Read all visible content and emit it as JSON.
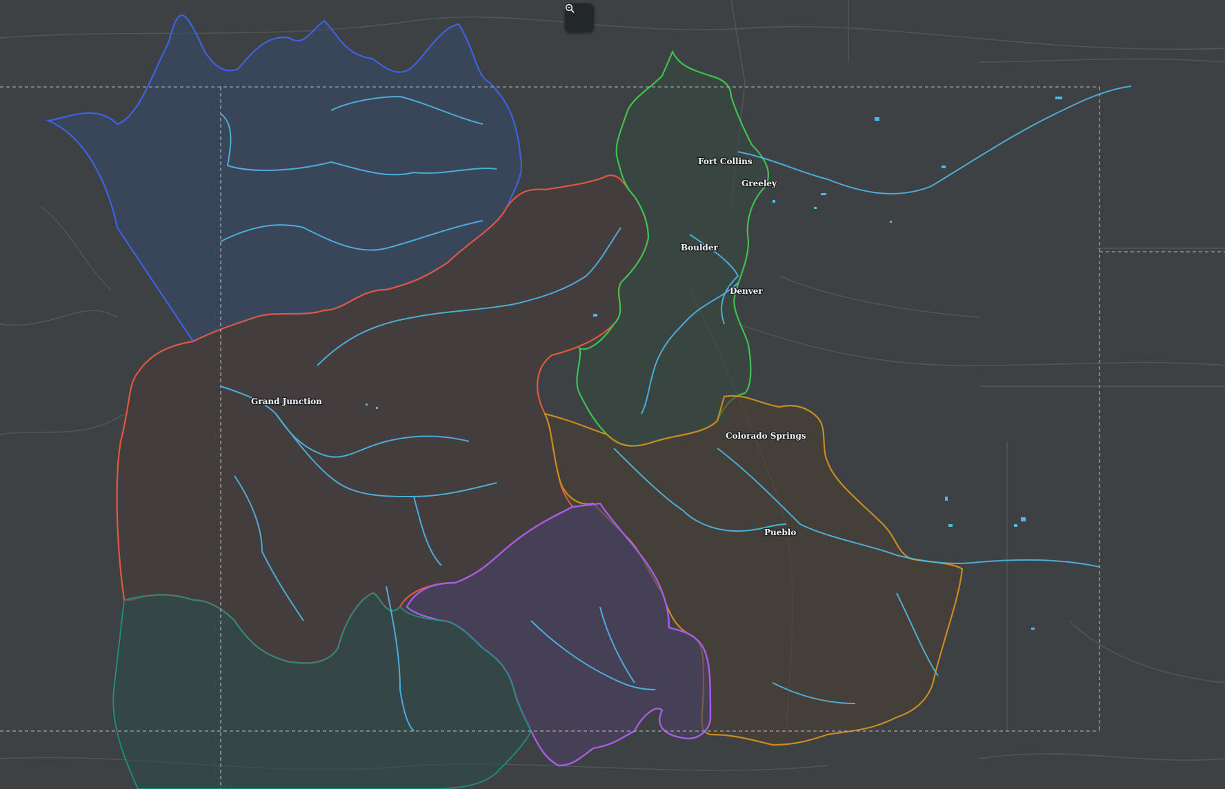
{
  "map": {
    "cities": [
      {
        "name": "Fort Collins"
      },
      {
        "name": "Greeley"
      },
      {
        "name": "Boulder"
      },
      {
        "name": "Denver"
      },
      {
        "name": "Grand Junction"
      },
      {
        "name": "Colorado Springs"
      },
      {
        "name": "Pueblo"
      }
    ],
    "basins": [
      {
        "id": "yampa-white",
        "color": "#3d63e0"
      },
      {
        "id": "colorado",
        "color": "#e0583e"
      },
      {
        "id": "south-platte",
        "color": "#3ec24f"
      },
      {
        "id": "arkansas",
        "color": "#c98a22"
      },
      {
        "id": "rio-grande",
        "color": "#a85ce6"
      },
      {
        "id": "san-juan-dolores",
        "color": "#1f8f80"
      }
    ],
    "colors": {
      "background": "#3d4144",
      "rivers": "#4fb8e8",
      "state_border": "#9a9fa3",
      "roads": "#5a5f63"
    }
  },
  "controls": {
    "zoom_icon": "zoom-out-icon"
  }
}
